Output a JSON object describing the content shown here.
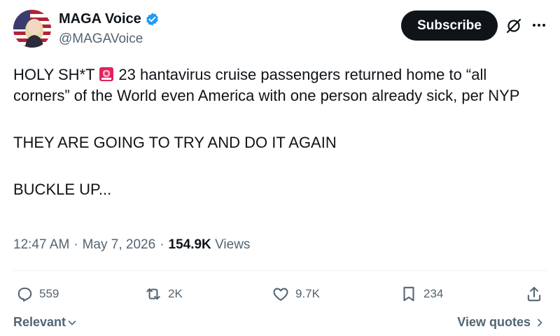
{
  "author": {
    "display_name": "MAGA Voice",
    "handle": "@MAGAVoice",
    "avatar_icon": "flag-woman-avatar",
    "verified_color": "#1d9bf0"
  },
  "header": {
    "subscribe_label": "Subscribe",
    "grok_icon": "grok-icon",
    "more_icon": "more-icon"
  },
  "tweet": {
    "line1_start": "HOLY SH*T",
    "line1_rest": "23 hantavirus cruise passengers returned home to “all corners” of the World even America with one person already sick, per NYP",
    "line2": "THEY ARE GOING TO TRY AND DO IT AGAIN",
    "line3": "BUCKLE UP..."
  },
  "meta": {
    "time": "12:47 AM",
    "date": "May 7, 2026",
    "views_count": "154.9K",
    "views_label": "Views",
    "separator": "·"
  },
  "actions": {
    "replies": "559",
    "reposts": "2K",
    "likes": "9.7K",
    "bookmarks": "234"
  },
  "footer": {
    "sort_label": "Relevant",
    "view_quotes_label": "View quotes"
  },
  "colors": {
    "text": "#0f1419",
    "secondary": "#536471",
    "button_bg": "#0f1419",
    "siren": "#e0245e"
  }
}
